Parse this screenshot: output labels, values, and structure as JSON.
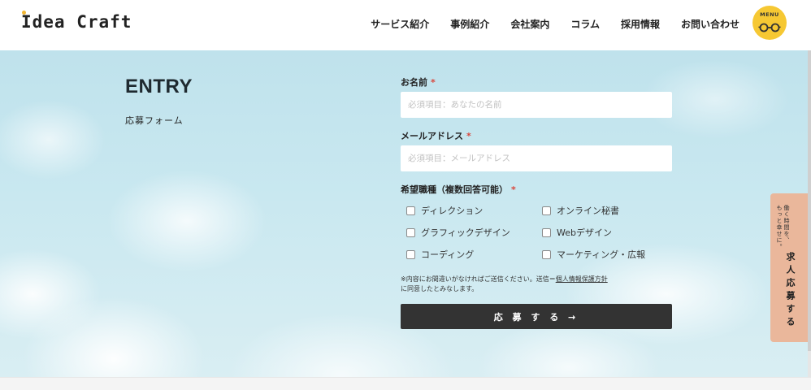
{
  "header": {
    "logo": "Idea Craft",
    "nav": [
      "サービス紹介",
      "事例紹介",
      "会社案内",
      "コラム",
      "採用情報",
      "お問い合わせ"
    ],
    "menu_label": "MENU",
    "menu_icon": "glasses-icon"
  },
  "hero": {
    "title": "ENTRY",
    "subtitle": "応募フォーム"
  },
  "form": {
    "name_label": "お名前",
    "name_placeholder": "必須項目：あなたの名前",
    "email_label": "メールアドレス",
    "email_placeholder": "必須項目：メールアドレス",
    "job_label": "希望職種（複数回答可能）",
    "required_mark": "*",
    "jobs": [
      "ディレクション",
      "オンライン秘書",
      "グラフィックデザイン",
      "Webデザイン",
      "コーディング",
      "マーケティング・広報"
    ],
    "notice_before": "※内容にお間違いがなければご送信ください。送信＝",
    "notice_link": "個人情報保護方針",
    "notice_after": "に同意したとみなします。",
    "submit_label": "応 募 す る →"
  },
  "side_tab": {
    "small_line1": "働く時間を、",
    "small_line2": "もっと幸せに。",
    "big": "求人応募する"
  },
  "colors": {
    "accent_yellow": "#f6c833",
    "side_tab": "#eab79b",
    "submit_bg": "#333333",
    "required": "#d9463b"
  }
}
